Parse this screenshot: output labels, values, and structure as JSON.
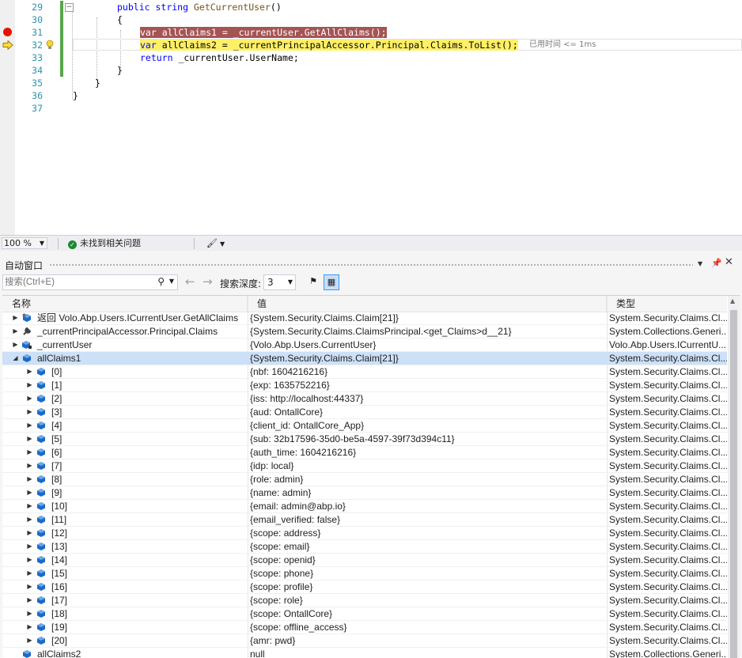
{
  "editor": {
    "lines": [
      {
        "num": "29",
        "text": "public string GetCurrentUser()"
      },
      {
        "num": "30",
        "text": "{"
      },
      {
        "num": "31",
        "text": "var allClaims1 = _currentUser.GetAllClaims();"
      },
      {
        "num": "32",
        "text": "var allClaims2 = _currentPrincipalAccessor.Principal.Claims.ToList();"
      },
      {
        "num": "33",
        "text": "return _currentUser.UserName;"
      },
      {
        "num": "34",
        "text": "}"
      },
      {
        "num": "35",
        "text": "}"
      },
      {
        "num": "36",
        "text": "}"
      },
      {
        "num": "37",
        "text": ""
      }
    ],
    "perf_tip": "已用时间 <= 1ms"
  },
  "status_bar": {
    "zoom": "100 %",
    "issues": "未找到相关问题"
  },
  "autos": {
    "title": "自动窗口",
    "search_placeholder": "搜索(Ctrl+E)",
    "depth_label": "搜索深度:",
    "depth_value": "3",
    "columns": {
      "name": "名称",
      "value": "值",
      "type": "类型"
    },
    "rows": [
      {
        "name": "返回 Volo.Abp.Users.ICurrentUser.GetAllClaims",
        "value": "{System.Security.Claims.Claim[21]}",
        "type": "System.Security.Claims.Cl...",
        "icon": "return-value-icon",
        "expander": "expand"
      },
      {
        "name": "_currentPrincipalAccessor.Principal.Claims",
        "value": "{System.Security.Claims.ClaimsPrincipal.<get_Claims>d__21}",
        "type": "System.Collections.Generi...",
        "icon": "wrench-property-icon",
        "expander": "expand"
      },
      {
        "name": "_currentUser",
        "value": "{Volo.Abp.Users.CurrentUser}",
        "type": "Volo.Abp.Users.ICurrentU...",
        "icon": "private-field-icon",
        "expander": "expand"
      },
      {
        "name": "allClaims1",
        "value": "{System.Security.Claims.Claim[21]}",
        "type": "System.Security.Claims.Cl...",
        "icon": "variable-icon",
        "expander": "collapse"
      },
      {
        "name": "[0]",
        "value": "{nbf: 1604216216}",
        "type": "System.Security.Claims.Cl...",
        "icon": "variable-icon",
        "expander": "expand"
      },
      {
        "name": "[1]",
        "value": "{exp: 1635752216}",
        "type": "System.Security.Claims.Cl...",
        "icon": "variable-icon",
        "expander": "expand"
      },
      {
        "name": "[2]",
        "value": "{iss: http://localhost:44337}",
        "type": "System.Security.Claims.Cl...",
        "icon": "variable-icon",
        "expander": "expand"
      },
      {
        "name": "[3]",
        "value": "{aud: OntallCore}",
        "type": "System.Security.Claims.Cl...",
        "icon": "variable-icon",
        "expander": "expand"
      },
      {
        "name": "[4]",
        "value": "{client_id: OntallCore_App}",
        "type": "System.Security.Claims.Cl...",
        "icon": "variable-icon",
        "expander": "expand"
      },
      {
        "name": "[5]",
        "value": "{sub: 32b17596-35d0-be5a-4597-39f73d394c11}",
        "type": "System.Security.Claims.Cl...",
        "icon": "variable-icon",
        "expander": "expand"
      },
      {
        "name": "[6]",
        "value": "{auth_time: 1604216216}",
        "type": "System.Security.Claims.Cl...",
        "icon": "variable-icon",
        "expander": "expand"
      },
      {
        "name": "[7]",
        "value": "{idp: local}",
        "type": "System.Security.Claims.Cl...",
        "icon": "variable-icon",
        "expander": "expand"
      },
      {
        "name": "[8]",
        "value": "{role: admin}",
        "type": "System.Security.Claims.Cl...",
        "icon": "variable-icon",
        "expander": "expand"
      },
      {
        "name": "[9]",
        "value": "{name: admin}",
        "type": "System.Security.Claims.Cl...",
        "icon": "variable-icon",
        "expander": "expand"
      },
      {
        "name": "[10]",
        "value": "{email: admin@abp.io}",
        "type": "System.Security.Claims.Cl...",
        "icon": "variable-icon",
        "expander": "expand"
      },
      {
        "name": "[11]",
        "value": "{email_verified: false}",
        "type": "System.Security.Claims.Cl...",
        "icon": "variable-icon",
        "expander": "expand"
      },
      {
        "name": "[12]",
        "value": "{scope: address}",
        "type": "System.Security.Claims.Cl...",
        "icon": "variable-icon",
        "expander": "expand"
      },
      {
        "name": "[13]",
        "value": "{scope: email}",
        "type": "System.Security.Claims.Cl...",
        "icon": "variable-icon",
        "expander": "expand"
      },
      {
        "name": "[14]",
        "value": "{scope: openid}",
        "type": "System.Security.Claims.Cl...",
        "icon": "variable-icon",
        "expander": "expand"
      },
      {
        "name": "[15]",
        "value": "{scope: phone}",
        "type": "System.Security.Claims.Cl...",
        "icon": "variable-icon",
        "expander": "expand"
      },
      {
        "name": "[16]",
        "value": "{scope: profile}",
        "type": "System.Security.Claims.Cl...",
        "icon": "variable-icon",
        "expander": "expand"
      },
      {
        "name": "[17]",
        "value": "{scope: role}",
        "type": "System.Security.Claims.Cl...",
        "icon": "variable-icon",
        "expander": "expand"
      },
      {
        "name": "[18]",
        "value": "{scope: OntallCore}",
        "type": "System.Security.Claims.Cl...",
        "icon": "variable-icon",
        "expander": "expand"
      },
      {
        "name": "[19]",
        "value": "{scope: offline_access}",
        "type": "System.Security.Claims.Cl...",
        "icon": "variable-icon",
        "expander": "expand"
      },
      {
        "name": "[20]",
        "value": "{amr: pwd}",
        "type": "System.Security.Claims.Cl...",
        "icon": "variable-icon",
        "expander": "expand"
      },
      {
        "name": "allClaims2",
        "value": "null",
        "type": "System.Collections.Generi...",
        "icon": "variable-icon",
        "expander": "none"
      }
    ],
    "selected_row": 3
  },
  "colors": {
    "breakpoint": "#e51400",
    "breakpoint_line": "#a55454",
    "current_line": "#fff067",
    "selection": "#cce0f7",
    "line_number": "#2b91af",
    "keyword": "#0000ff"
  }
}
